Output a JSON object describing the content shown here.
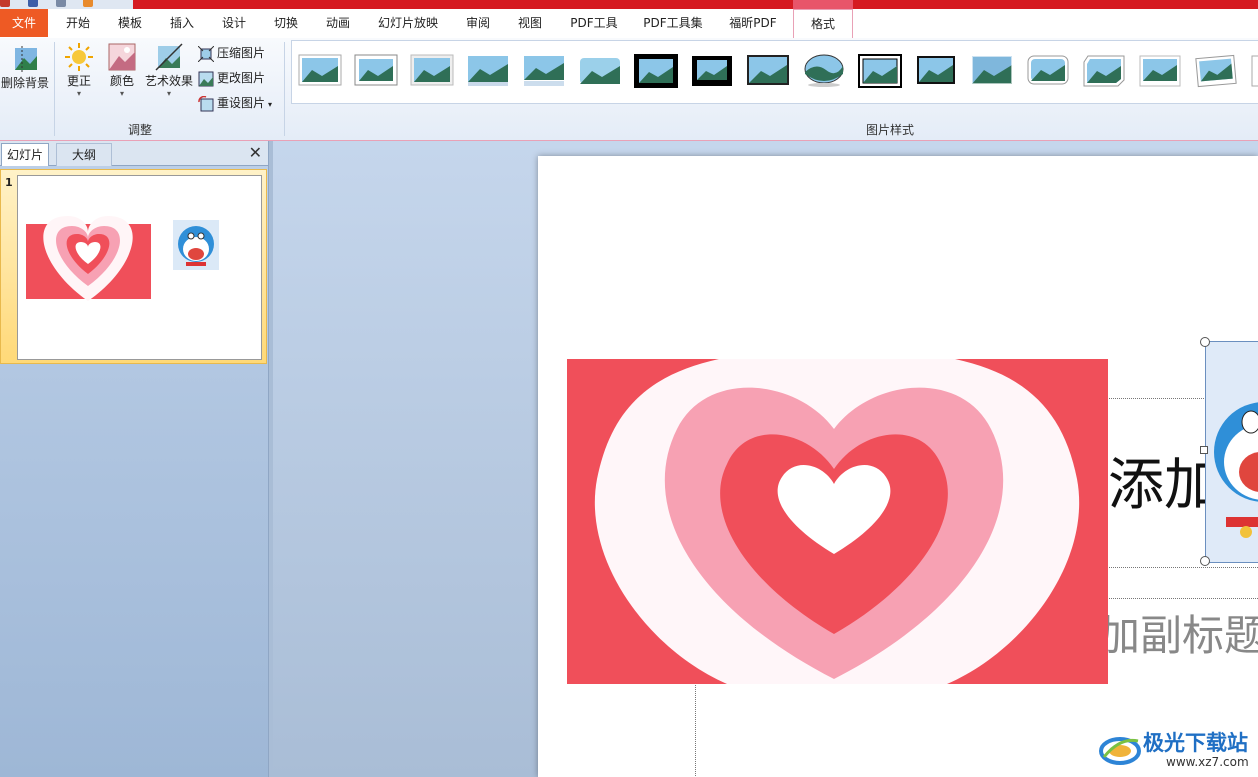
{
  "ribbon_tabs": [
    "文件",
    "开始",
    "模板",
    "插入",
    "设计",
    "切换",
    "动画",
    "幻灯片放映",
    "审阅",
    "视图",
    "PDF工具",
    "PDF工具集",
    "福昕PDF",
    "格式"
  ],
  "ribbon": {
    "remove_bg": "删除背景",
    "correct": "更正",
    "color": "颜色",
    "art_effects": "艺术效果",
    "compress": "压缩图片",
    "change": "更改图片",
    "reset": "重设图片",
    "group_adjust": "调整",
    "group_styles": "图片样式"
  },
  "pane": {
    "tab_slides": "幻灯片",
    "tab_outline": "大纲",
    "close": "✕",
    "slide_number": "1"
  },
  "slide": {
    "title_partial": "添加标",
    "subtitle_partial": "加副标题"
  },
  "watermark": {
    "title": "极光下载站",
    "url": "www.xz7.com"
  },
  "colors": {
    "file_tab": "#ee5a24",
    "accent_pink": "#e9a1b6",
    "heart_red": "#f04f5a",
    "heart_pink": "#f7a1b3"
  }
}
